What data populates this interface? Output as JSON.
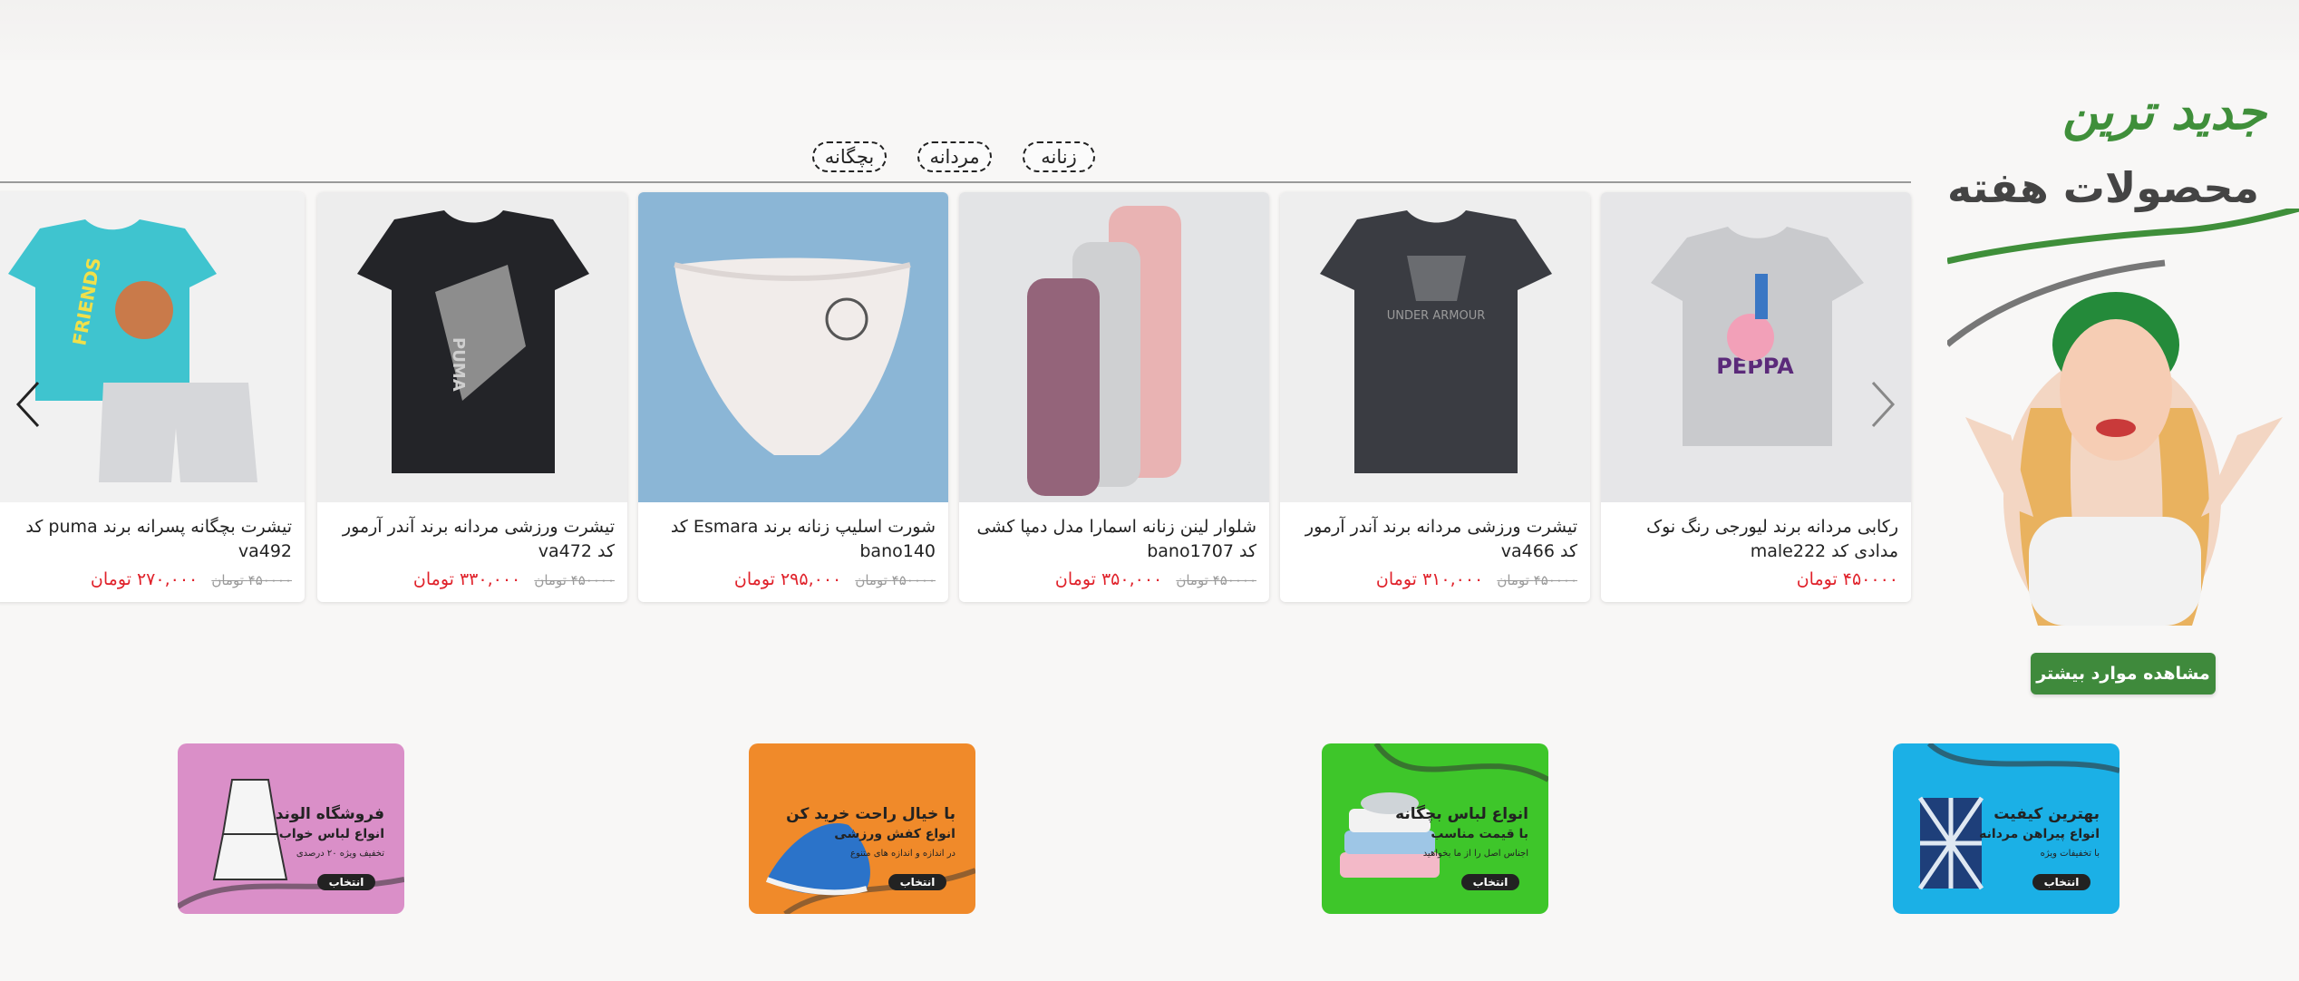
{
  "hero": {
    "title_new": "جدید ترین",
    "title_week": "محصولات هفته",
    "more_button": "مشاهده موارد بیشتر"
  },
  "categories": [
    "زنانه",
    "مردانه",
    "بچگانه"
  ],
  "products": [
    {
      "name": "رکابی مردانه برند لیورجی رنگ نوک مدادی کد male222",
      "old_price": "",
      "price": "۴۵۰۰۰۰ تومان"
    },
    {
      "name": "تیشرت ورزشی مردانه برند آندر آرمور کد va466",
      "old_price": "۴۵۰۰۰۰ تومان",
      "price": "۳۱۰,۰۰۰ تومان"
    },
    {
      "name": "شلوار لینن زنانه اسمارا مدل دمپا کشی کد bano1707",
      "old_price": "۴۵۰۰۰۰ تومان",
      "price": "۳۵۰,۰۰۰ تومان"
    },
    {
      "name": "شورت اسلیپ زنانه برند Esmara کد bano140",
      "old_price": "۴۵۰۰۰۰ تومان",
      "price": "۲۹۵,۰۰۰ تومان"
    },
    {
      "name": "تیشرت ورزشی مردانه برند آندر آرمور کد va472",
      "old_price": "۴۵۰۰۰۰ تومان",
      "price": "۳۳۰,۰۰۰ تومان"
    },
    {
      "name": "تیشرت بچگانه پسرانه برند puma کد va492",
      "old_price": "۴۵۰۰۰۰ تومان",
      "price": "۲۷۰,۰۰۰ تومان"
    }
  ],
  "product_image_text": {
    "peppa": "PEPPA",
    "under_armour": "UNDER ARMOUR",
    "puma": "PUMA",
    "friends": "FRIENDS"
  },
  "banners": [
    {
      "title": "بهترین کیفیت",
      "subtitle": "انواع پیراهن مردانه",
      "note": "با تخفیفات ویژه",
      "button": "انتخاب",
      "color": "#1bb0e6"
    },
    {
      "title": "انواع لباس بچگانه",
      "subtitle": "با قیمت مناسب",
      "note": "اجناس اصل را از ما بخواهید",
      "button": "انتخاب",
      "color": "#3ec62a"
    },
    {
      "title": "با خیال راحت خرید کن",
      "subtitle": "انواع کفش ورزشی",
      "note": "در اندازه و اندازه های متنوع",
      "button": "انتخاب",
      "color": "#f08a2a"
    },
    {
      "title": "فروشگاه الوند",
      "subtitle": "انواع لباس خواب",
      "note": "تخفیف ویژه ۲۰ درصدی",
      "button": "انتخاب",
      "color": "#da8fc8"
    }
  ],
  "icons": [
    "chevron-left-icon",
    "chevron-right-icon"
  ],
  "colors": {
    "brand_green": "#3f8a3c",
    "price_red": "#e0212a"
  }
}
